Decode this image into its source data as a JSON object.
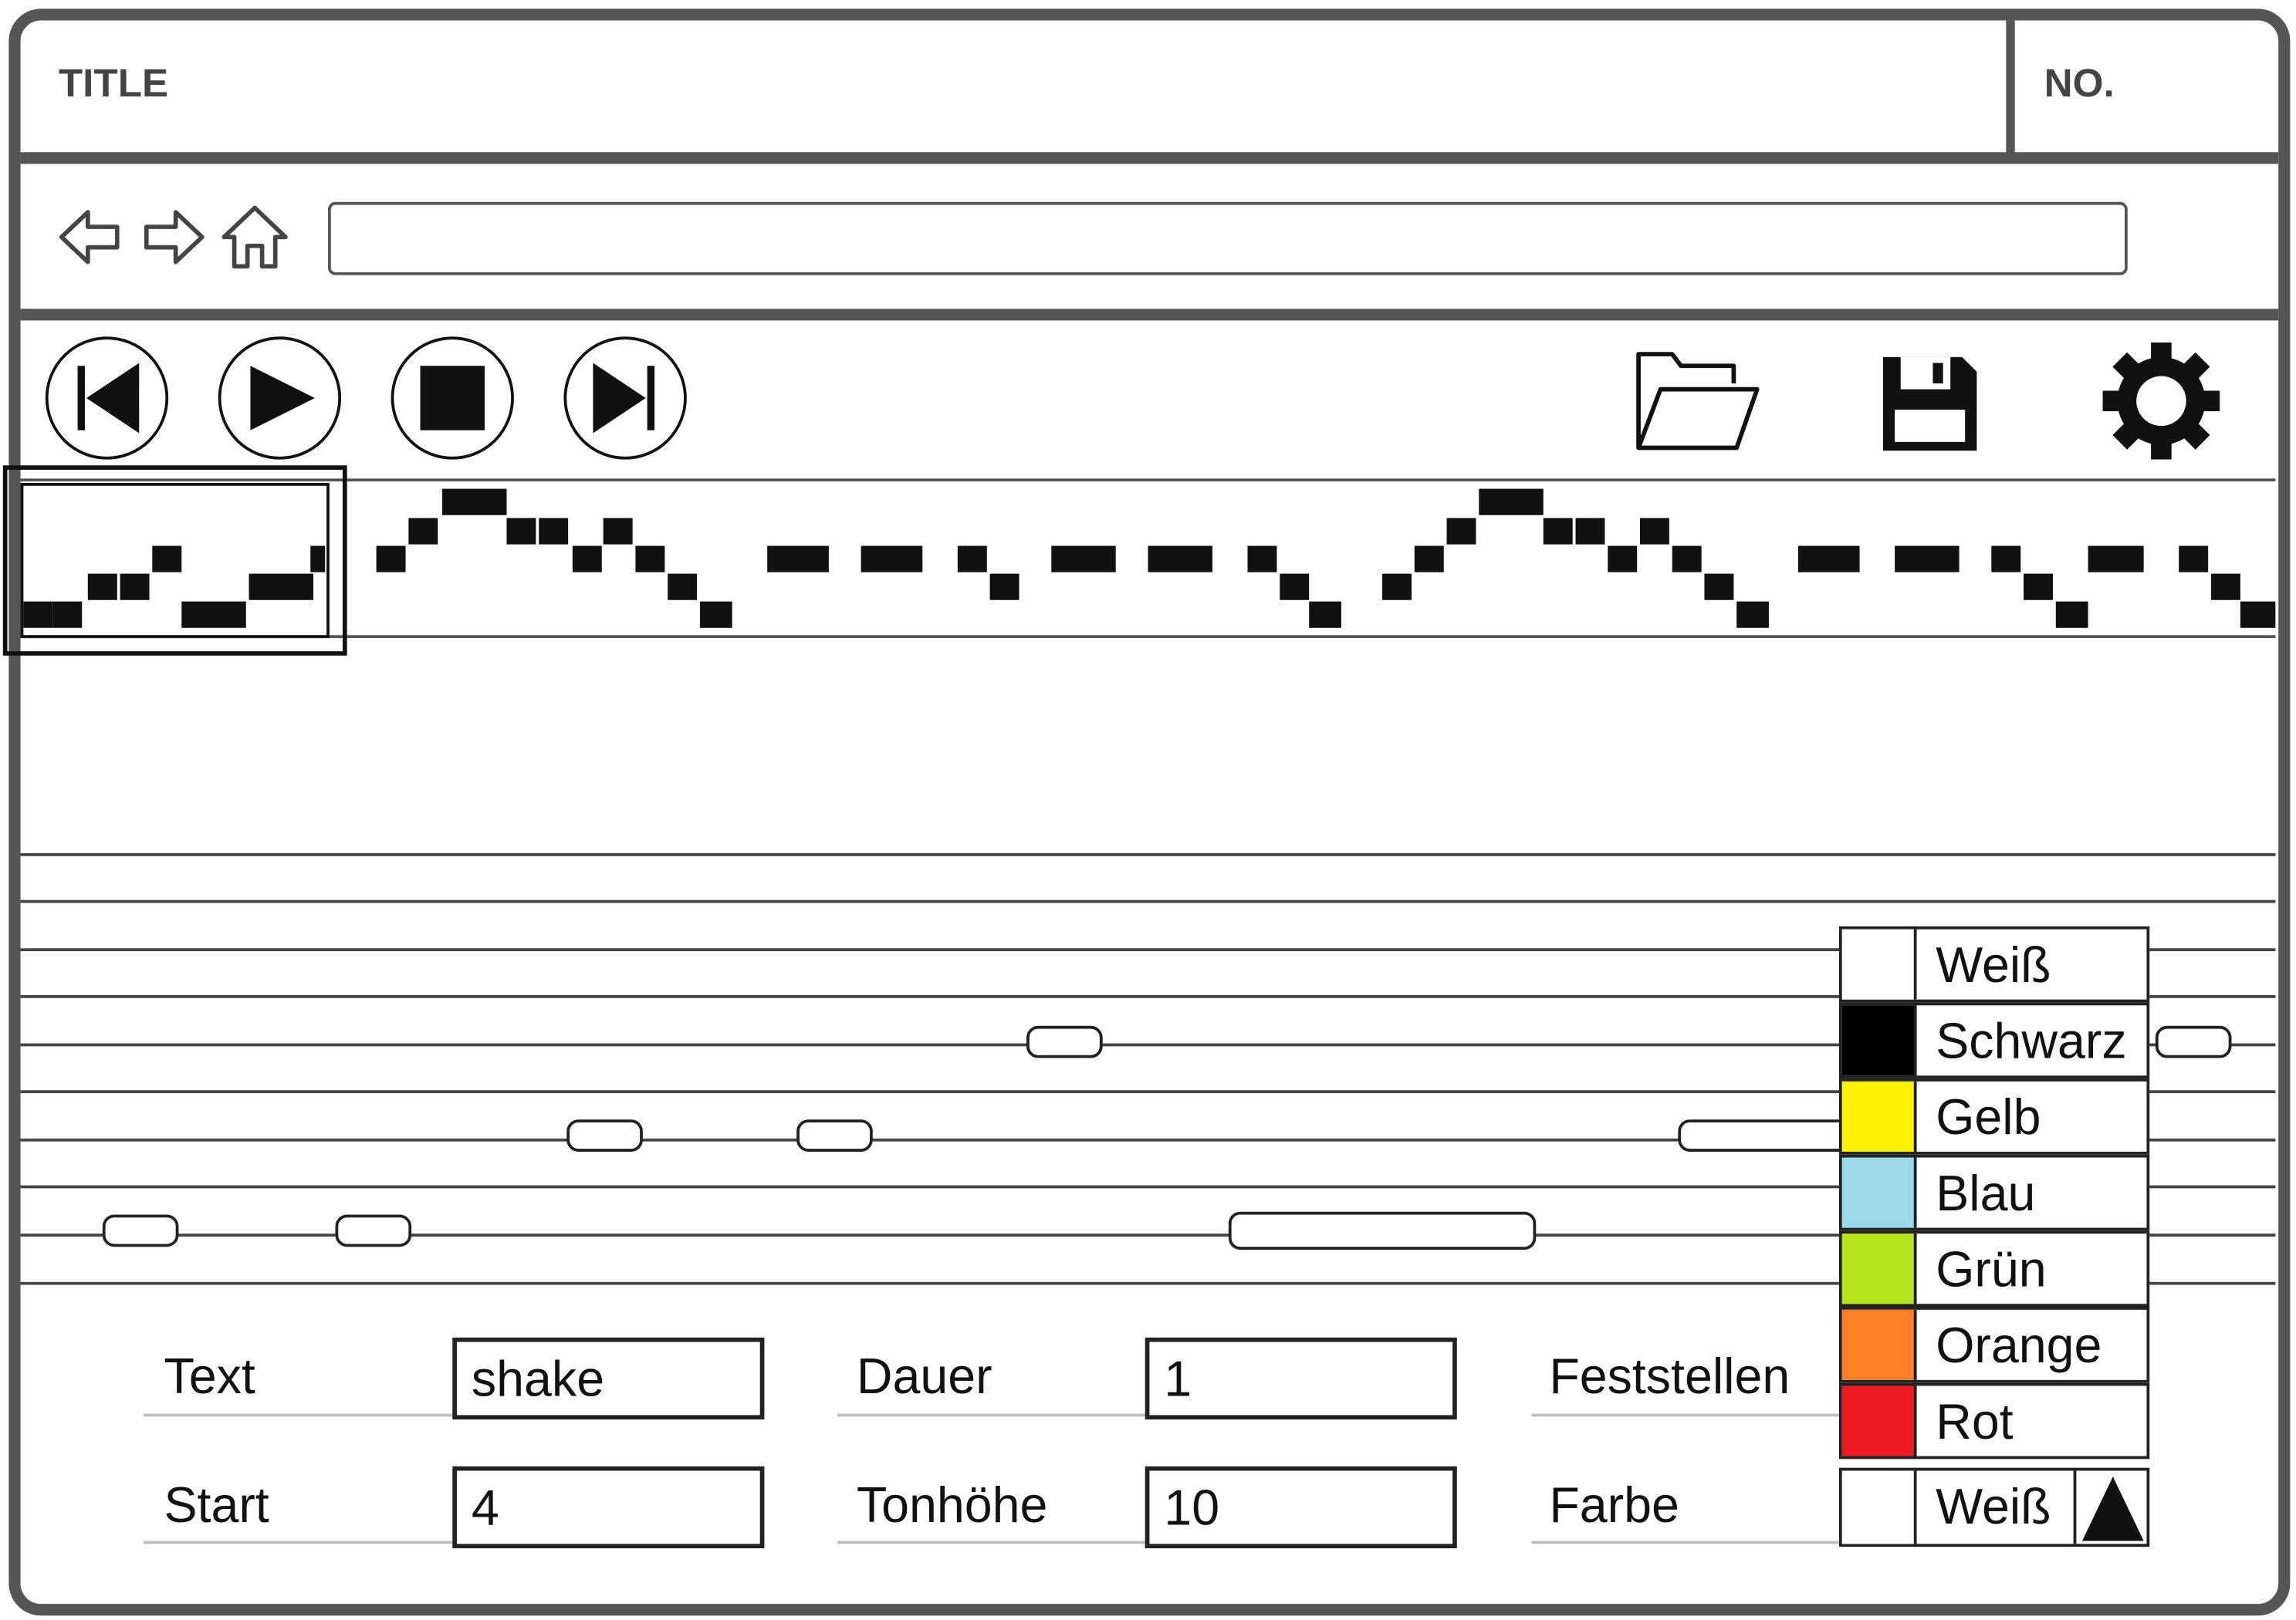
{
  "window": {
    "title": "TITLE",
    "number": "NO."
  },
  "nav": {
    "address_value": ""
  },
  "icons": {
    "back": "arrow-left-icon",
    "forward": "arrow-right-icon",
    "home": "home-icon",
    "skip_back": "skip-back-icon",
    "play": "play-icon",
    "stop": "stop-icon",
    "skip_forward": "skip-forward-icon",
    "open": "folder-open-icon",
    "save": "save-icon",
    "settings": "gear-icon"
  },
  "form": {
    "text_label": "Text",
    "text_value": "shake",
    "start_label": "Start",
    "start_value": "4",
    "dauer_label": "Dauer",
    "dauer_value": "1",
    "tonhoehe_label": "Tonhöhe",
    "tonhoehe_value": "10",
    "feststellen_label": "Feststellen",
    "farbe_label": "Farbe",
    "farbe_selected": "Weiß"
  },
  "colors": [
    {
      "name": "Weiß",
      "hex": "#ffffff"
    },
    {
      "name": "Schwarz",
      "hex": "#000000"
    },
    {
      "name": "Gelb",
      "hex": "#fff200"
    },
    {
      "name": "Blau",
      "hex": "#99d9ea"
    },
    {
      "name": "Grün",
      "hex": "#b5e61d"
    },
    {
      "name": "Orange",
      "hex": "#ff7f27"
    },
    {
      "name": "Rot",
      "hex": "#ed1c24"
    }
  ],
  "selected_color_hex": "#ffffff"
}
